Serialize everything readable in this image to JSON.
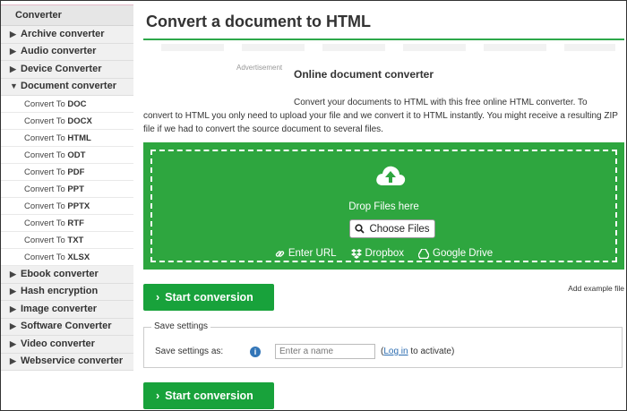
{
  "sidebar": {
    "header": "Converter",
    "categories_top": [
      {
        "label": "Archive converter"
      },
      {
        "label": "Audio converter"
      },
      {
        "label": "Device Converter"
      }
    ],
    "active_category": "Document converter",
    "sub_prefix": "Convert To ",
    "sub_items": [
      "DOC",
      "DOCX",
      "HTML",
      "ODT",
      "PDF",
      "PPT",
      "PPTX",
      "RTF",
      "TXT",
      "XLSX"
    ],
    "categories_bottom": [
      {
        "label": "Ebook converter"
      },
      {
        "label": "Hash encryption"
      },
      {
        "label": "Image converter"
      },
      {
        "label": "Software Converter"
      },
      {
        "label": "Video converter"
      },
      {
        "label": "Webservice converter"
      }
    ]
  },
  "main": {
    "title": "Convert a document to HTML",
    "ad_label": "Advertisement",
    "subtitle": "Online document converter",
    "description_line1": "Convert your documents to HTML with this free online HTML converter. To",
    "description_rest": "convert to HTML you only need to upload your file and we convert it to HTML instantly. You might receive a resulting ZIP file if we had to convert the source document to several files.",
    "drop": {
      "text": "Drop Files here",
      "choose_label": "Choose Files",
      "enter_url": "Enter URL",
      "dropbox": "Dropbox",
      "google_drive": "Google Drive"
    },
    "start_label": "Start conversion",
    "add_example": "Add example file",
    "settings": {
      "legend": "Save settings",
      "label": "Save settings as:",
      "placeholder": "Enter a name",
      "login_prefix": "(",
      "login_link": "Log in",
      "login_suffix": " to activate)"
    }
  },
  "colors": {
    "accent": "#2ea63f",
    "button": "#18a23b",
    "info": "#3376b8"
  }
}
